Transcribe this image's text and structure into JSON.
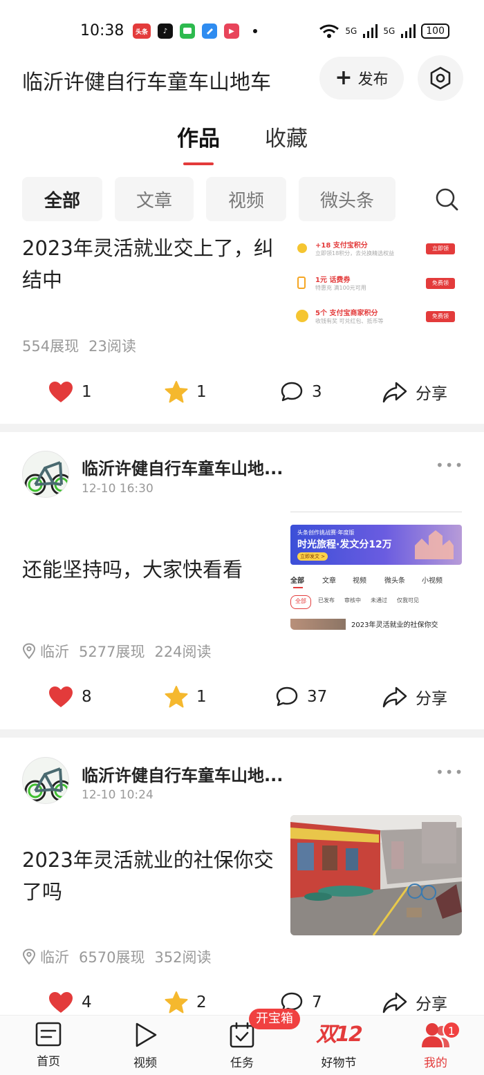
{
  "status_bar": {
    "time": "10:38",
    "apps": [
      {
        "icon": "toutiao-app-icon",
        "label": "头条",
        "color": "#e33b3b"
      },
      {
        "icon": "tiktok-app-icon",
        "label": "♪",
        "color": "#111111"
      },
      {
        "icon": "messages-app-icon",
        "label": "",
        "color": "#2dba4e"
      },
      {
        "icon": "blue-app-icon",
        "label": "",
        "color": "#2f8cf0"
      },
      {
        "icon": "video-app-icon",
        "label": "▶",
        "color": "#e8445a"
      }
    ],
    "network_1": "5G",
    "network_2": "5G",
    "battery": "100"
  },
  "header": {
    "title": "临沂许健自行车童车山地车",
    "publish_label": "发布"
  },
  "main_tabs": {
    "works": "作品",
    "favorites": "收藏"
  },
  "filters": [
    "全部",
    "文章",
    "视频",
    "微头条"
  ],
  "posts": [
    {
      "title": "2023年灵活就业交上了，纠结中",
      "views": "554展现",
      "reads": "23阅读",
      "likes": "1",
      "stars": "1",
      "comments": "3",
      "share": "分享",
      "thumb_rows": [
        {
          "title": "+18 支付宝积分",
          "sub": "立即领18积分，去兑换精选权益",
          "btn": "立即领"
        },
        {
          "title": "1元 话费券",
          "sub": "特惠充 满100元可用",
          "btn": "免费领"
        },
        {
          "title": "5个 支付宝商家积分",
          "sub": "收钱有奖 可兑红包、抵币等",
          "btn": "免费领"
        }
      ]
    },
    {
      "author": "临沂许健自行车童车山地...",
      "date": "12-10 16:30",
      "title": "还能坚持吗，大家快看看",
      "location": "临沂",
      "views": "5277展现",
      "reads": "224阅读",
      "likes": "8",
      "stars": "1",
      "comments": "37",
      "share": "分享",
      "thumb": {
        "banner_small": "头条创作挑战赛·年度版",
        "banner_big": "时光旅程·发文分12万",
        "banner_btn": "立即发文 >",
        "tabs": [
          "全部",
          "文章",
          "视频",
          "微头条",
          "小视频"
        ],
        "chips": [
          "全部",
          "已发布",
          "审核中",
          "未通过",
          "仅我可见"
        ],
        "row_text": "2023年灵活就业的社保你交"
      }
    },
    {
      "author": "临沂许健自行车童车山地...",
      "date": "12-10 10:24",
      "title": "2023年灵活就业的社保你交了吗",
      "location": "临沂",
      "views": "6570展现",
      "reads": "352阅读",
      "likes": "4",
      "stars": "2",
      "comments": "7",
      "share": "分享"
    }
  ],
  "bottom_nav": {
    "home": "首页",
    "video": "视频",
    "tasks": "任务",
    "tasks_badge": "开宝箱",
    "festival": "好物节",
    "festival_logo": "双12",
    "mine": "我的",
    "mine_badge": "1"
  },
  "colors": {
    "accent_red": "#e33b3b",
    "star_yellow": "#f5b82e",
    "meta_gray": "#999999"
  }
}
